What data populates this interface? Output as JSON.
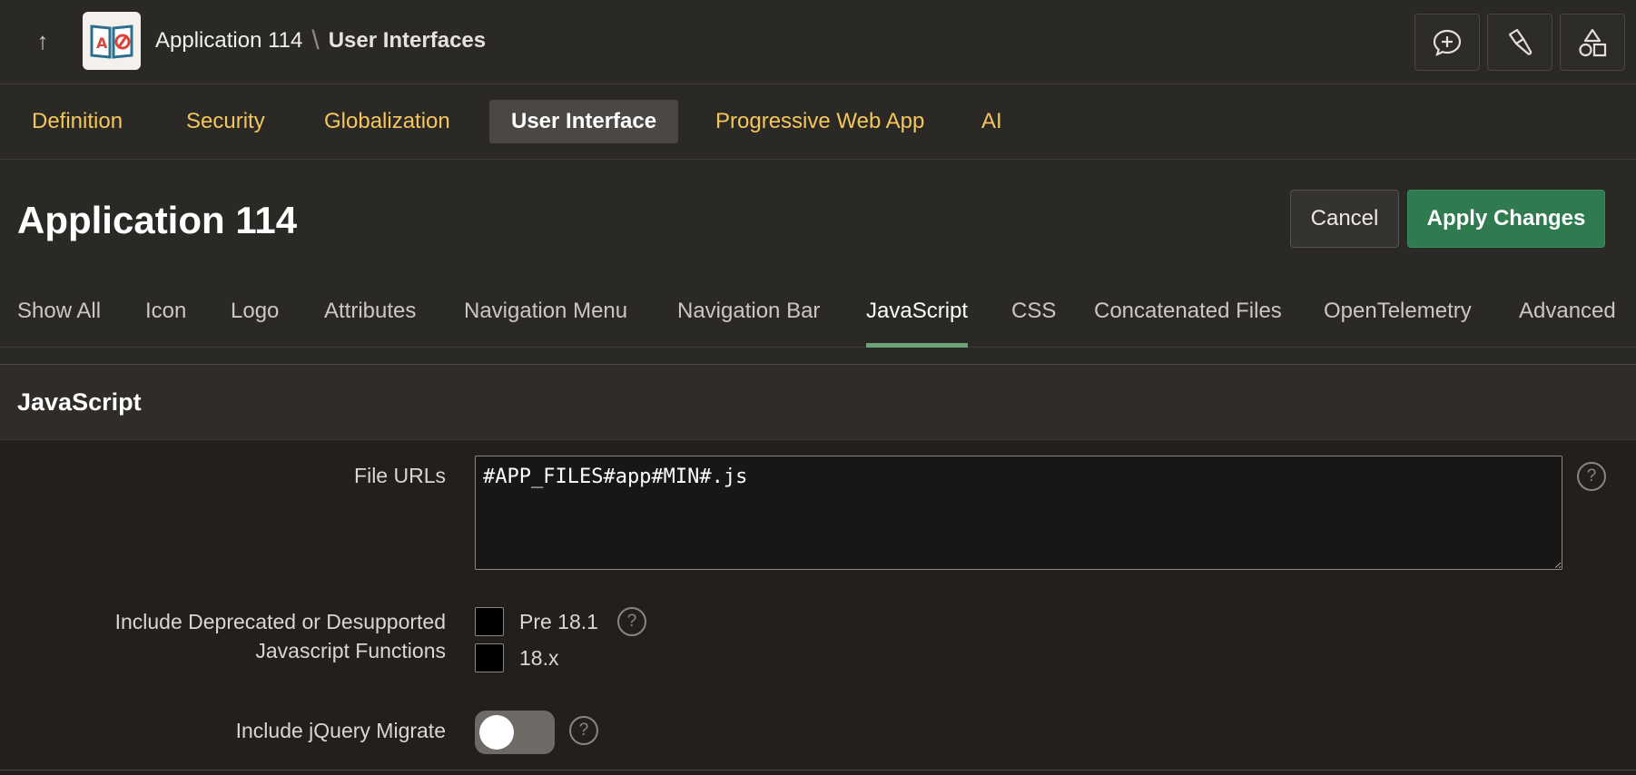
{
  "header": {
    "up_icon": "arrow-up-icon",
    "app_logo_icon": "app-book-logo-icon",
    "breadcrumb": {
      "app": "Application 114",
      "separator": "\\",
      "current": "User Interfaces"
    },
    "actions": [
      "add-comment-icon",
      "flashlight-icon",
      "shapes-icon"
    ]
  },
  "primary_nav": {
    "items": [
      {
        "label": "Definition",
        "active": false
      },
      {
        "label": "Security",
        "active": false
      },
      {
        "label": "Globalization",
        "active": false
      },
      {
        "label": "User Interface",
        "active": true
      },
      {
        "label": "Progressive Web App",
        "active": false
      },
      {
        "label": "AI",
        "active": false
      }
    ]
  },
  "page": {
    "title": "Application 114",
    "cancel_label": "Cancel",
    "apply_label": "Apply Changes"
  },
  "sub_tabs": {
    "items": [
      {
        "label": "Show All",
        "active": false
      },
      {
        "label": "Icon",
        "active": false
      },
      {
        "label": "Logo",
        "active": false
      },
      {
        "label": "Attributes",
        "active": false
      },
      {
        "label": "Navigation Menu",
        "active": false
      },
      {
        "label": "Navigation Bar",
        "active": false
      },
      {
        "label": "JavaScript",
        "active": true
      },
      {
        "label": "CSS",
        "active": false
      },
      {
        "label": "Concatenated Files",
        "active": false
      },
      {
        "label": "OpenTelemetry",
        "active": false
      },
      {
        "label": "Advanced",
        "active": false
      }
    ]
  },
  "region": {
    "title": "JavaScript",
    "file_urls": {
      "label": "File URLs",
      "value": "#APP_FILES#app#MIN#.js"
    },
    "deprecated": {
      "label_line1": "Include Deprecated or Desupported",
      "label_line2": "Javascript Functions",
      "options": [
        {
          "label": "Pre 18.1",
          "checked": false
        },
        {
          "label": "18.x",
          "checked": false
        }
      ]
    },
    "jquery_migrate": {
      "label": "Include jQuery Migrate",
      "enabled": false
    },
    "help_glyph": "?"
  },
  "colors": {
    "accent_nav": "#f4c75d",
    "apply_button": "#2f7a4e",
    "active_tab_underline": "#6aa377",
    "background": "#2b2926"
  }
}
